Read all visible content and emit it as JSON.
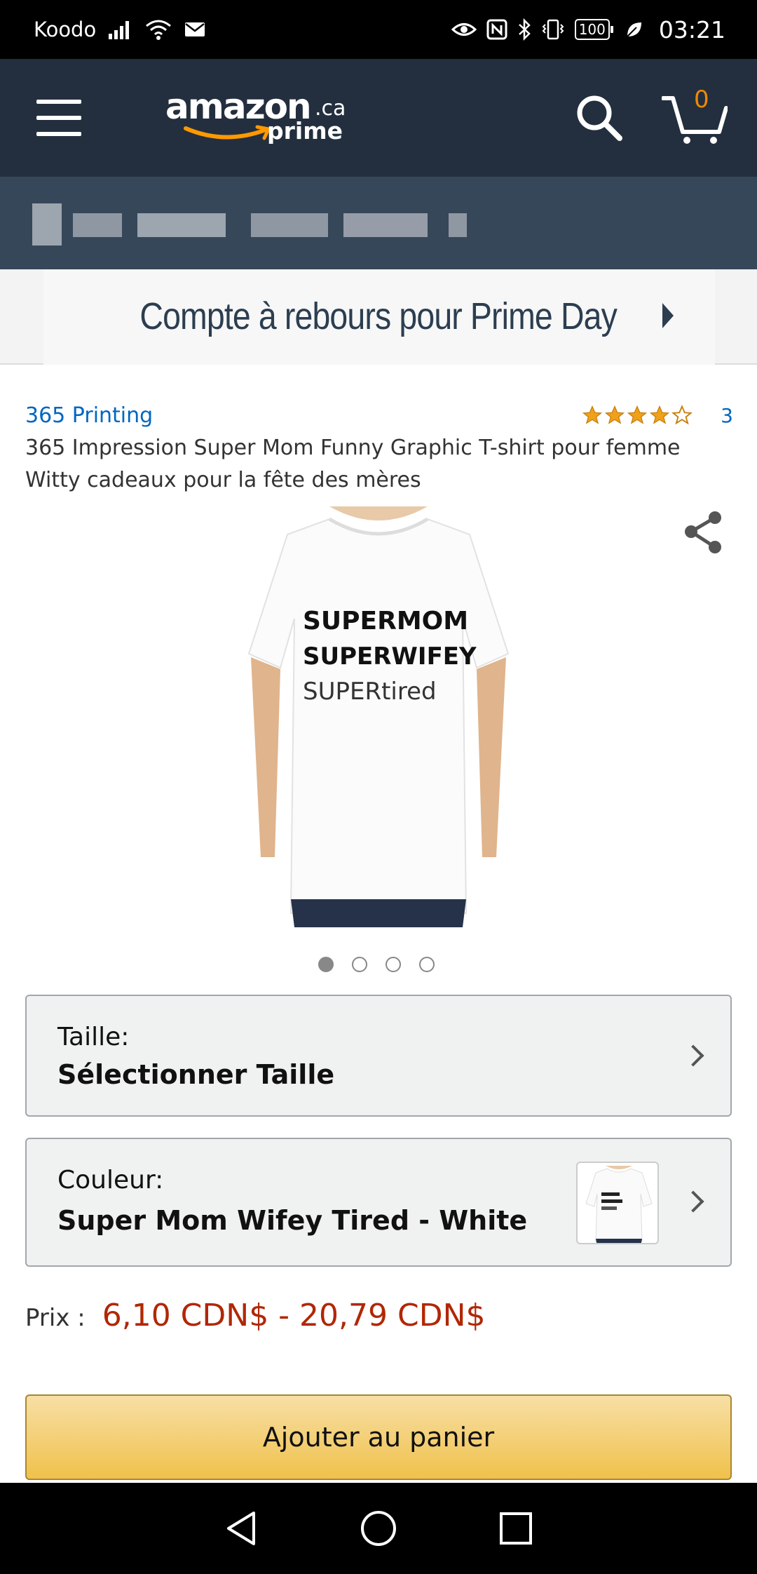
{
  "status_bar": {
    "carrier": "Koodo",
    "battery": "100",
    "time": "03:21"
  },
  "header": {
    "logo_main": "amazon",
    "logo_tld": ".ca",
    "logo_sub": "prime",
    "cart_count": "0"
  },
  "banner": {
    "text": "Compte à rebours pour Prime Day"
  },
  "product": {
    "brand": "365 Printing",
    "rating_stars": 4,
    "rating_count": "3",
    "title": "365 Impression Super Mom Funny Graphic T-shirt pour femme Witty cadeaux pour la fête des mères",
    "shirt_lines": [
      "SUPERMOM",
      "SUPERWIFEY",
      "SUPERtired"
    ],
    "image_count": 4,
    "active_image": 0
  },
  "selectors": {
    "size_label": "Taille:",
    "size_value": "Sélectionner Taille",
    "color_label": "Couleur:",
    "color_value": "Super Mom Wifey Tired - White"
  },
  "price": {
    "label": "Prix :",
    "value": "6,10 CDN$ - 20,79 CDN$"
  },
  "actions": {
    "add_to_cart": "Ajouter au panier"
  },
  "colors": {
    "header_bg": "#232f3e",
    "link": "#0066c0",
    "price": "#b12704",
    "star": "#f0a019",
    "cart_button": "#f0c14b"
  },
  "icons": [
    "signal-icon",
    "wifi-icon",
    "mail-icon",
    "eye-icon",
    "nfc-icon",
    "bluetooth-icon",
    "vibrate-icon",
    "battery-icon",
    "leaf-icon",
    "menu-icon",
    "search-icon",
    "cart-icon",
    "share-icon",
    "chevron-right-icon",
    "back-icon",
    "home-icon",
    "recents-icon"
  ]
}
